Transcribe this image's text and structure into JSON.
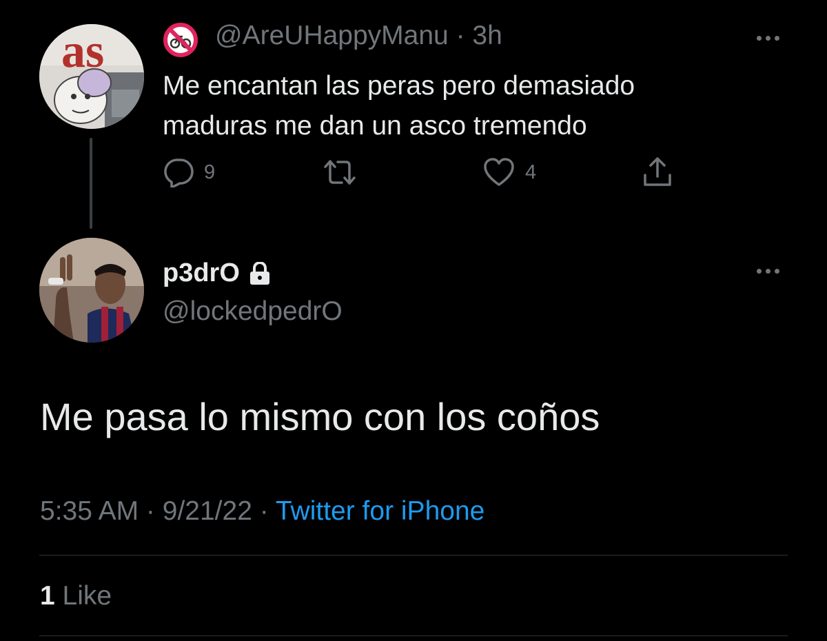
{
  "parent_tweet": {
    "handle": "@AreUHappyManu",
    "separator": " · ",
    "time": "3h",
    "text": "Me encantan las peras pero demasiado maduras me dan un asco tremendo",
    "avatar_text": "as",
    "badge_icon": "no-bicycles-icon",
    "reply_count": "9",
    "like_count": "4"
  },
  "reply_tweet": {
    "display_name": "p3drO",
    "handle": "@lockedpedrO",
    "lock_icon": "lock-icon",
    "text": "Me pasa lo mismo con los coños",
    "time": "5:35 AM",
    "sep1": " · ",
    "date": "9/21/22",
    "sep2": " · ",
    "source": "Twitter for iPhone"
  },
  "stats": {
    "like_count": "1",
    "like_label": "Like"
  },
  "colors": {
    "background": "#000000",
    "text": "#e7e9ea",
    "secondary": "#71767b",
    "link": "#1d9bf0"
  }
}
